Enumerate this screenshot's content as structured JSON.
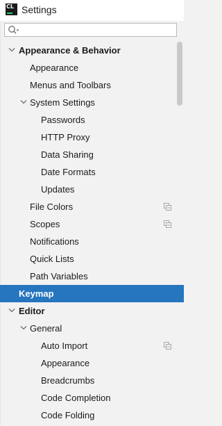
{
  "window": {
    "app_icon_text": "CL",
    "title": "Settings"
  },
  "search": {
    "value": "",
    "placeholder": ""
  },
  "icons": {
    "app": "clion-logo-icon",
    "search": "search-icon",
    "expanded": "chevron-down-icon",
    "project_scope": "project-settings-icon"
  },
  "colors": {
    "selection": "#2675bf",
    "background": "#f2f2f2"
  },
  "tree": {
    "items": [
      {
        "label": "Appearance & Behavior",
        "level": 0,
        "expanded": true,
        "bold": true
      },
      {
        "label": "Appearance",
        "level": 1
      },
      {
        "label": "Menus and Toolbars",
        "level": 1
      },
      {
        "label": "System Settings",
        "level": 1,
        "expanded": true
      },
      {
        "label": "Passwords",
        "level": 2
      },
      {
        "label": "HTTP Proxy",
        "level": 2
      },
      {
        "label": "Data Sharing",
        "level": 2
      },
      {
        "label": "Date Formats",
        "level": 2
      },
      {
        "label": "Updates",
        "level": 2
      },
      {
        "label": "File Colors",
        "level": 1,
        "project_icon": true
      },
      {
        "label": "Scopes",
        "level": 1,
        "project_icon": true
      },
      {
        "label": "Notifications",
        "level": 1
      },
      {
        "label": "Quick Lists",
        "level": 1
      },
      {
        "label": "Path Variables",
        "level": 1
      },
      {
        "label": "Keymap",
        "level": 0,
        "bold": true,
        "selected": true
      },
      {
        "label": "Editor",
        "level": 0,
        "expanded": true,
        "bold": true
      },
      {
        "label": "General",
        "level": 1,
        "expanded": true
      },
      {
        "label": "Auto Import",
        "level": 2,
        "project_icon": true
      },
      {
        "label": "Appearance",
        "level": 2
      },
      {
        "label": "Breadcrumbs",
        "level": 2
      },
      {
        "label": "Code Completion",
        "level": 2
      },
      {
        "label": "Code Folding",
        "level": 2
      }
    ]
  }
}
